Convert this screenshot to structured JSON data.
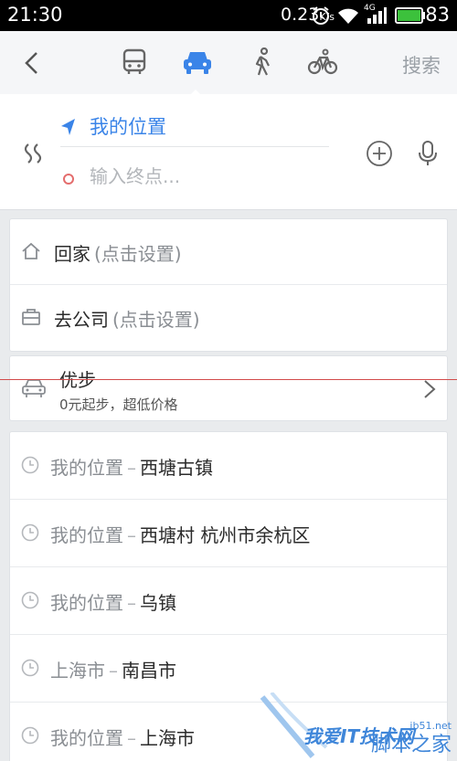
{
  "status_bar": {
    "time": "21:30",
    "rate": "0.23",
    "rate_unit": "K/s",
    "network": "4G",
    "battery": "83"
  },
  "header": {
    "tabs": [
      {
        "name": "bus",
        "icon": "bus-icon"
      },
      {
        "name": "car",
        "icon": "car-icon",
        "selected": true
      },
      {
        "name": "walk",
        "icon": "walk-icon"
      },
      {
        "name": "bike",
        "icon": "bike-icon"
      }
    ],
    "search_label": "搜索",
    "accent": "#3a84e8"
  },
  "route": {
    "start": "我的位置",
    "end_placeholder": "输入终点..."
  },
  "shortcuts": [
    {
      "label": "回家",
      "hint": "(点击设置)",
      "icon": "home-icon"
    },
    {
      "label": "去公司",
      "hint": "(点击设置)",
      "icon": "briefcase-icon"
    }
  ],
  "youbu": {
    "title": "优步",
    "subtitle": "0元起步，超低价格"
  },
  "history": [
    {
      "from": "我的位置",
      "to": "西塘古镇"
    },
    {
      "from": "我的位置",
      "to": "西塘村 杭州市余杭区"
    },
    {
      "from": "我的位置",
      "to": "乌镇"
    },
    {
      "from": "上海市",
      "to": "南昌市"
    },
    {
      "from": "我的位置",
      "to": "上海市"
    }
  ],
  "history_separator": "–",
  "watermark": {
    "title": "我爱IT技术网",
    "site": "jb51.net",
    "brand": "脚本之家"
  }
}
